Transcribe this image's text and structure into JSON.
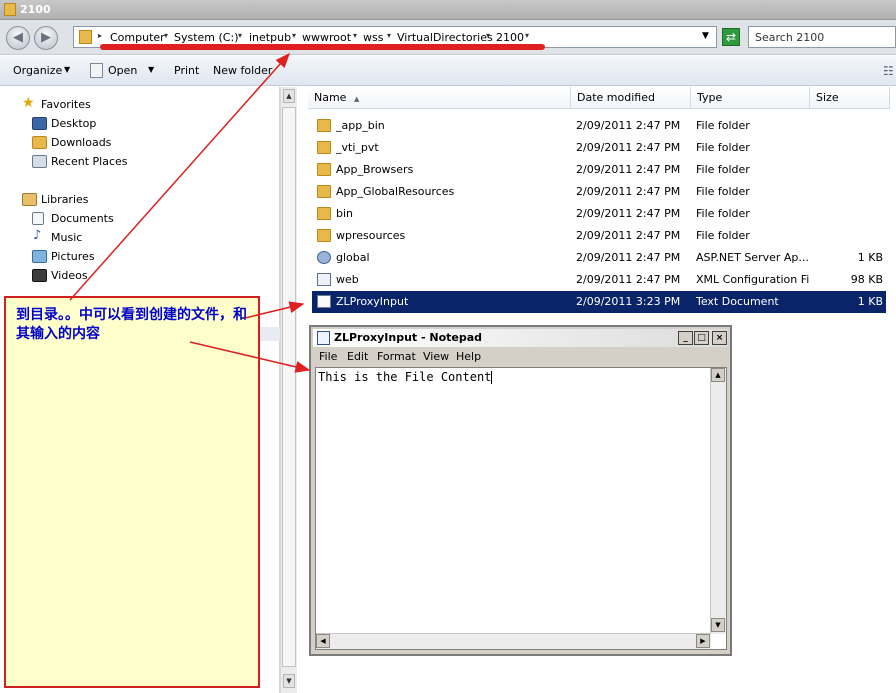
{
  "window": {
    "title": "2100"
  },
  "address": {
    "crumbs": [
      "Computer",
      "System (C:)",
      "inetpub",
      "wwwroot",
      "wss",
      "VirtualDirectories",
      "2100"
    ],
    "search_placeholder": "Search 2100"
  },
  "toolbar": {
    "organize": "Organize",
    "open": "Open",
    "print": "Print",
    "new_folder": "New folder"
  },
  "nav": {
    "favorites_header": "Favorites",
    "favorites": [
      "Desktop",
      "Downloads",
      "Recent Places"
    ],
    "libraries_header": "Libraries",
    "libraries": [
      "Documents",
      "Music",
      "Pictures",
      "Videos"
    ]
  },
  "columns": {
    "name": "Name",
    "date": "Date modified",
    "type": "Type",
    "size": "Size"
  },
  "files": [
    {
      "name": "_app_bin",
      "date": "2/09/2011 2:47 PM",
      "type": "File folder",
      "size": "",
      "icon": "folder"
    },
    {
      "name": "_vti_pvt",
      "date": "2/09/2011 2:47 PM",
      "type": "File folder",
      "size": "",
      "icon": "folder"
    },
    {
      "name": "App_Browsers",
      "date": "2/09/2011 2:47 PM",
      "type": "File folder",
      "size": "",
      "icon": "folder"
    },
    {
      "name": "App_GlobalResources",
      "date": "2/09/2011 2:47 PM",
      "type": "File folder",
      "size": "",
      "icon": "folder"
    },
    {
      "name": "bin",
      "date": "2/09/2011 2:47 PM",
      "type": "File folder",
      "size": "",
      "icon": "folder"
    },
    {
      "name": "wpresources",
      "date": "2/09/2011 2:47 PM",
      "type": "File folder",
      "size": "",
      "icon": "folder"
    },
    {
      "name": "global",
      "date": "2/09/2011 2:47 PM",
      "type": "ASP.NET Server Ap...",
      "size": "1 KB",
      "icon": "aspx"
    },
    {
      "name": "web",
      "date": "2/09/2011 2:47 PM",
      "type": "XML Configuration File",
      "size": "98 KB",
      "icon": "xml"
    },
    {
      "name": "ZLProxyInput",
      "date": "2/09/2011 3:23 PM",
      "type": "Text Document",
      "size": "1 KB",
      "icon": "txt",
      "selected": true
    }
  ],
  "note": {
    "text": "到目录。。中可以看到创建的文件，和其输入的内容"
  },
  "notepad": {
    "title": "ZLProxyInput - Notepad",
    "menu": [
      "File",
      "Edit",
      "Format",
      "View",
      "Help"
    ],
    "content": "This is the File Content"
  },
  "colors": {
    "selection": "#0a246a",
    "annotation_red": "#e02020",
    "note_bg": "#ffffcc",
    "note_text": "#0000cc"
  }
}
